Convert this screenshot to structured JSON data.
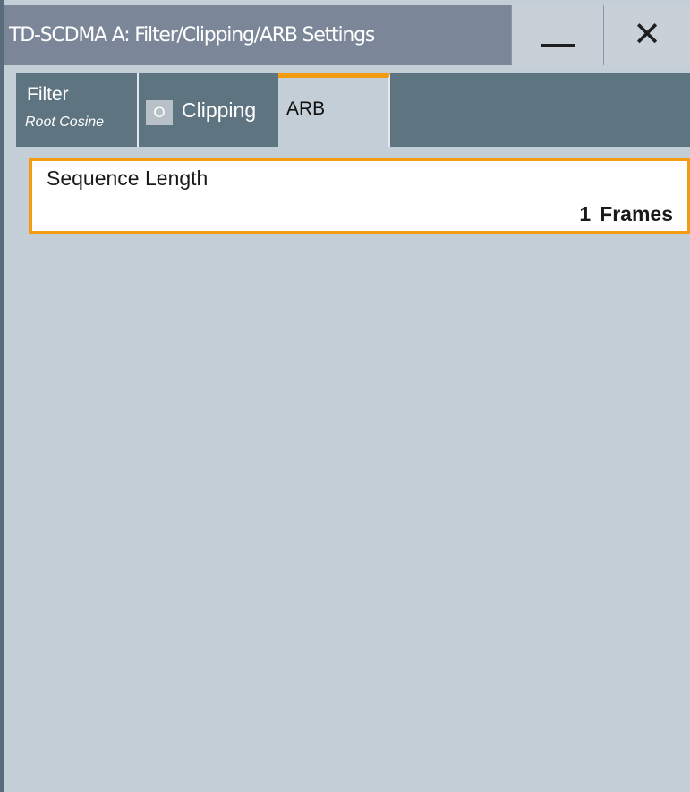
{
  "window": {
    "title": "TD-SCDMA A: Filter/Clipping/ARB Settings",
    "minimize_icon": "minimize-icon",
    "close_icon": "close-icon",
    "close_glyph": "✕"
  },
  "tabs": {
    "filter": {
      "label": "Filter",
      "sublabel": "Root Cosine"
    },
    "clipping": {
      "label": "Clipping",
      "checkbox_state": "O"
    },
    "arb": {
      "label": "ARB",
      "selected": true
    }
  },
  "arb": {
    "sequence_length": {
      "label": "Sequence Length",
      "value": "1",
      "unit": "Frames"
    }
  },
  "colors": {
    "accent": "#f39c12",
    "title_bar": "#7b8798",
    "tab_bar": "#5e7481",
    "panel_background": "#c3ced6"
  }
}
